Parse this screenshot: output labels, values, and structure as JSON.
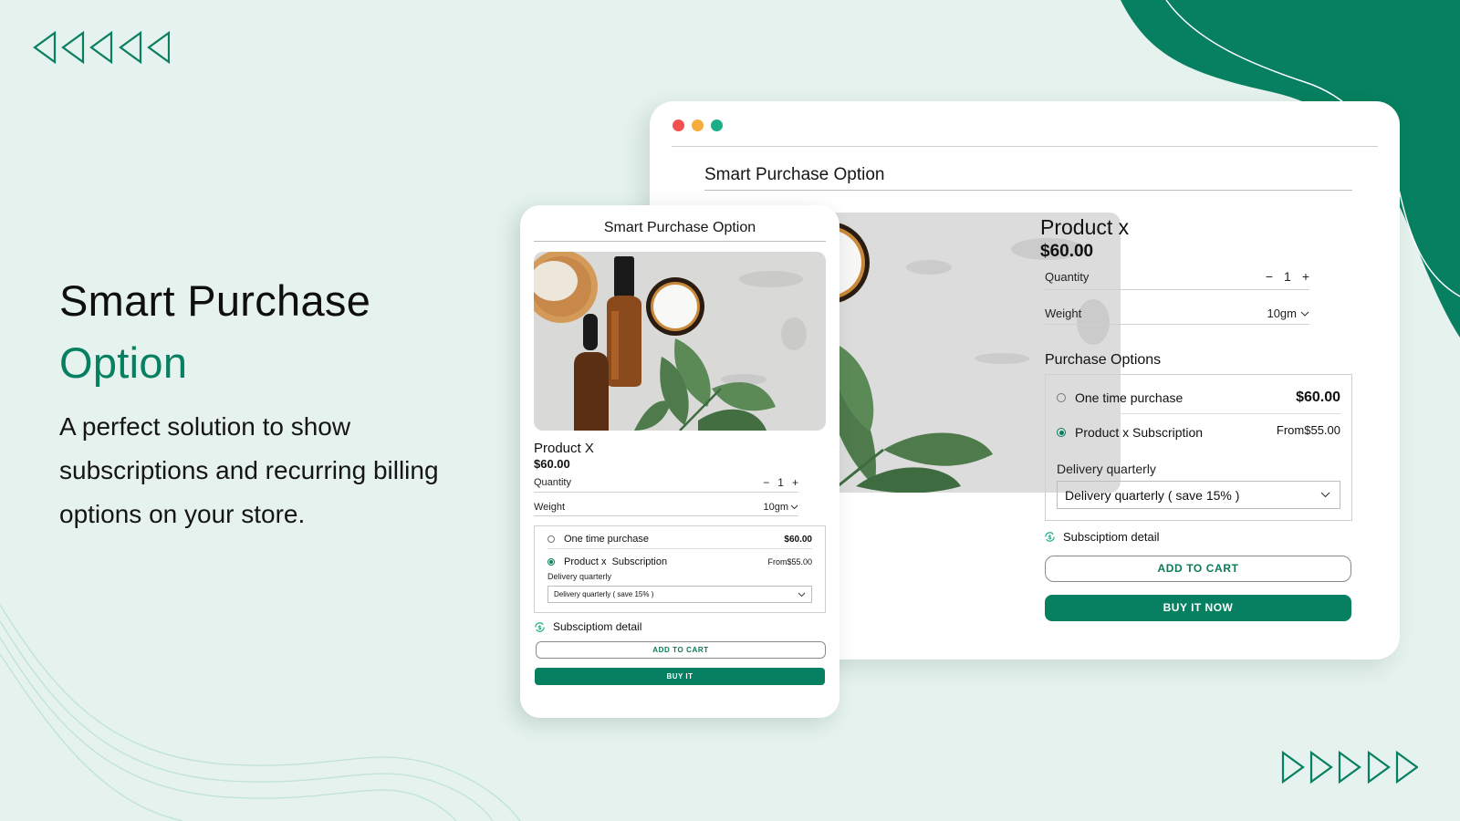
{
  "colors": {
    "brand_green": "#068060",
    "background": "#e5f2ee",
    "dot_red": "#f0504f",
    "dot_yellow": "#f5ad3b",
    "dot_green": "#1aae87"
  },
  "decorations": {
    "top_left_icon": "triangle-left-outline-x5",
    "bottom_right_icon": "triangle-right-outline-x5"
  },
  "hero": {
    "title_line1": "Smart Purchase",
    "title_line2": "Option",
    "description": "A perfect solution to show subscriptions and recurring billing options on your store."
  },
  "desktop": {
    "window_controls": [
      "close",
      "minimize",
      "maximize"
    ],
    "title": "Smart Purchase Option",
    "image": "cosmetics-bottles-cream-leaves-photo",
    "product": {
      "name": "Product x",
      "price": "$60.00",
      "quantity_label": "Quantity",
      "quantity_value": "1",
      "weight_label": "Weight",
      "weight_value": "10gm"
    },
    "purchase_options_title": "Purchase Options",
    "options": [
      {
        "label": "One time purchase",
        "price": "$60.00",
        "selected": false
      },
      {
        "label": "Product x Subscription",
        "price": "From$55.00",
        "selected": true
      }
    ],
    "delivery_label": "Delivery quarterly",
    "delivery_select_value": "Delivery quarterly ( save 15% )",
    "subscription_detail": "Subsciptiom detail",
    "add_to_cart": "ADD TO CART",
    "buy_now": "BUY IT NOW"
  },
  "mobile": {
    "title": "Smart Purchase Option",
    "image": "cosmetics-bottles-cream-leaves-photo",
    "product": {
      "name": "Product X",
      "price": "$60.00",
      "quantity_label": "Quantity",
      "quantity_value": "1",
      "weight_label": "Weight",
      "weight_value": "10gm"
    },
    "options": [
      {
        "label": "One time purchase",
        "price": "$60.00",
        "selected": false
      },
      {
        "label": "Product x  Subscription",
        "price": "From$55.00",
        "selected": true
      }
    ],
    "delivery_label": "Delivery quarterly",
    "delivery_select_value": "Delivery quarterly ( save 15% )",
    "subscription_detail": "Subsciptiom detail",
    "add_to_cart": "ADD TO CART",
    "buy_now": "BUY IT"
  }
}
